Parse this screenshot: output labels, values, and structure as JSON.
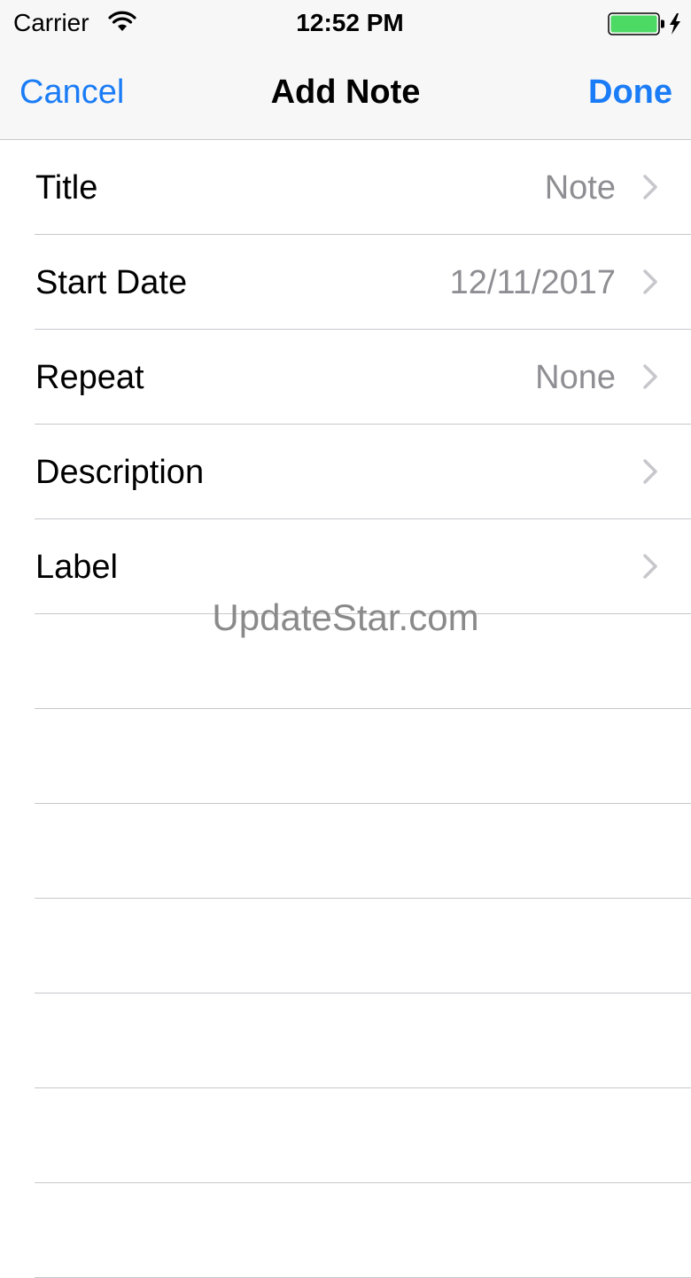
{
  "status_bar": {
    "carrier": "Carrier",
    "time": "12:52 PM",
    "wifi_icon": "wifi-icon",
    "battery_icon": "battery-charging-icon",
    "battery_color": "#4cd964"
  },
  "nav": {
    "cancel_label": "Cancel",
    "title": "Add Note",
    "done_label": "Done",
    "accent_color": "#1a7cf6"
  },
  "rows": [
    {
      "label": "Title",
      "value": "Note",
      "icon": "chevron-right-icon"
    },
    {
      "label": "Start Date",
      "value": "12/11/2017",
      "icon": "chevron-right-icon"
    },
    {
      "label": "Repeat",
      "value": "None",
      "icon": "chevron-right-icon"
    },
    {
      "label": "Description",
      "value": "",
      "icon": "chevron-right-icon"
    },
    {
      "label": "Label",
      "value": "",
      "icon": "chevron-right-icon"
    }
  ],
  "watermark": "UpdateStar.com"
}
